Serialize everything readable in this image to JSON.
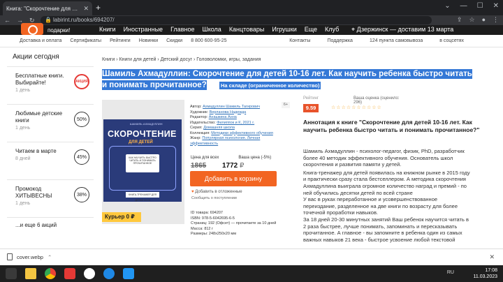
{
  "browser": {
    "tab_title": "Книга: \"Скорочтение для детей 1",
    "url": "labirint.ru/books/694207/"
  },
  "site_header": {
    "gifts": "подарки!",
    "menu": [
      "Книги",
      "Иностранные",
      "Главное",
      "Школа",
      "Канцтовары",
      "Игрушки",
      "Еще",
      "Клуб"
    ],
    "geo": "Дзержинск — доставим 13 марта"
  },
  "subnav": {
    "left": [
      "Доставка и оплата",
      "Сертификаты",
      "Рейтинги",
      "Новинки",
      "Скидки",
      "8 800 600-95-25"
    ],
    "right": [
      "Контакты",
      "Поддержка",
      "124 пункта самовывоза",
      "в соцсетях"
    ]
  },
  "sidebar": {
    "title": "Акции сегодня",
    "items": [
      {
        "name": "Бесплатные книги. Выбирайте!",
        "days": "1 день",
        "badge": "АКЦИЯ"
      },
      {
        "name": "Любимые детские книги",
        "days": "1 день",
        "badge": "50%"
      },
      {
        "name": "Читаем в марте",
        "days": "8 дней",
        "badge": "45%"
      },
      {
        "name": "Промокод ХИТЫВЕСНЫ",
        "days": "1 день",
        "badge": "38%"
      }
    ],
    "more": "...и еще 6 акций"
  },
  "breadcrumbs": [
    "Книги",
    "Книги для детей",
    "Детский досуг",
    "Головоломки, игры, задания"
  ],
  "product": {
    "title_line1": "Шамиль Ахмадуллин: Скорочтение для детей 10-16 лет. Как научить ребенка быстро читать",
    "title_line2": "и понимать прочитанное?",
    "stock": "На складе (ограниченное количество)",
    "age": "6+",
    "cover": {
      "brand": "ШАМИЛЬ АХМАДУЛЛИН",
      "big": "СКОРОЧТЕНИЕ",
      "sub": "ДЛЯ ДЕТЕЙ",
      "board": "КАК НАУЧИТЬ БЫСТРО ЧИТАТЬ И ПОНИМАТЬ ПРОЧИТАННОЕ",
      "tag": "КНИГА-ТРЕНАЖЕР ДЛЯ ДЕТЕЙ 10-16"
    },
    "courier": "Курьер 0 ₽",
    "info": [
      {
        "k": "Автор: ",
        "v": "Ахмадуллин Шамиль Тагирович"
      },
      {
        "k": "Художник: ",
        "v": "Верланова Надежда"
      },
      {
        "k": "Редактор: ",
        "v": "Анашкина Анна"
      },
      {
        "k": "Издательство: ",
        "v": "Филиппок и К, 2021 г."
      },
      {
        "k": "Серия: ",
        "v": "Домашняя школа"
      },
      {
        "k": "Коллекция: ",
        "v": "Методики эффективного обучения"
      },
      {
        "k": "Жанр: ",
        "v": "Популярная психология. Личная эффективность"
      }
    ],
    "price_label": "Цена для всех",
    "your_price_label": "Ваша цена (-5%)",
    "price_old": "1865",
    "price_new": "1772",
    "buy_label": "Добавить в корзину",
    "fav_label": "Добавить в отложенные",
    "report_label": "Сообщить о поступлении",
    "details": [
      "ID товара: 694207",
      "ISBN: 978-5-6042695-6-5",
      "Страниц: 192 (Офсет) — прочитаете за 10 дней",
      "Масса: 812 г",
      "Размеры: 248x250x20 мм"
    ],
    "rating_label": "Рейтинг",
    "rating": "9.59",
    "votes": "Ваша оценка (оценило: 296)",
    "annotation_title": "Аннотация к книге \"Скорочтение для детей 10-16 лет. Как научить ребенка быстро читать и понимать прочитанное?\"",
    "annotation": [
      "Шамиль Ахмадуллин - психолог-педагог, физик, PhD, разработчик более 40 методик эффективного обучения. Основатель школ скорочтения и развития памяти у детей.",
      "Книга-тренажер для детей появилась на книжном рынке в 2015 году и практически сразу стала бестселлером. А методика скорочтения Ахмадуллина выиграла огромное количество наград и премий - по ней обучились десятки детей по всей стране",
      "У вас в руках переработанное и усовершенствованное переиздание, разделенное на две книги по возрасту для более точечной проработки навыков.",
      "За 18 дней 20-30 минутных занятий Ваш ребенок научится читать в 2 раза быстрее, лучше понимать, запоминать и пересказывать прочитанное. А главное - вы запомните в ребенка один из самых важных навыков 21 века - быстрое усвоение любой текстовой"
    ]
  },
  "downloads": {
    "file": "cover.webp"
  },
  "taskbar": {
    "time": "17:08",
    "date": "11.03.2023",
    "lang": "RU"
  },
  "watermark": "Avito"
}
